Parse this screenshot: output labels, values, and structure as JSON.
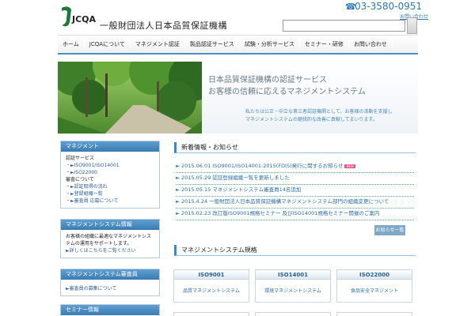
{
  "header": {
    "site_title": "一般財団法人日本品質保証機構",
    "phone": "03-3580-0951",
    "contact_link": "お問い合わせ",
    "logo_text": "JCQA",
    "search": {
      "value": "",
      "placeholder": ""
    }
  },
  "nav": {
    "items": [
      "ホーム",
      "JCQAについて",
      "マネジメント認証",
      "製品認証サービス",
      "試験・分析サービス",
      "セミナー・研修",
      "お問い合わせ"
    ]
  },
  "hero": {
    "heading_line1": "日本品質保証機構の認証サービス",
    "heading_line2": "お客様の信頼に応えるマネジメントシステム",
    "body_line1": "私たちは公正・中立な第三者認証機関として、お客様の活動を支援し",
    "body_line2": "マネジメントシステムの継続的な改善に貢献してまいります。"
  },
  "sidebar": {
    "boxes": [
      {
        "title": "マネジメント",
        "lines": [
          "認証サービス",
          "・►ISO9001/ISO14001",
          "・►ISO22000",
          "審査について",
          "・►認証取得の流れ",
          "・►登録組織一覧",
          "・►審査員 応募について"
        ]
      },
      {
        "title": "マネジメントシステム情報",
        "text": "お客様の組織に最適なマネジメントシステムの運用をサポートします。",
        "link": "►詳しくはこちらをご覧ください"
      },
      {
        "title": "マネジメントシステム審査員",
        "link": "►審査員の募集について"
      },
      {
        "title": "セミナー情報"
      }
    ]
  },
  "news": {
    "title": "新着情報・お知らせ",
    "items": [
      {
        "text": "2015.06.01 ISO9001/ISO14001:2015(FDIS)発行に関するお知らせ",
        "new": true
      },
      {
        "text": "2015.05.29 認証登録組織一覧を更新しました",
        "new": false
      },
      {
        "text": "2015.05.15 マネジメントシステム審査員14名追加",
        "new": false
      },
      {
        "text": "2015.4.24 一般財団法人日本品質保証機構マネジメントシステム部門の組織変更について",
        "new": false
      },
      {
        "text": "2015.02.23 改訂版ISO9001規格セミナー 及びISO14001規格セミナー開催のご案内",
        "new": false
      }
    ],
    "new_badge": "NEW",
    "more_button": "お知らせ一覧"
  },
  "standards": {
    "title": "マネジメントシステム規格",
    "cards": [
      {
        "name": "ISO9001",
        "link": "品質マネジメントシステム"
      },
      {
        "name": "ISO14001",
        "link": "環境マネジメントシステム"
      },
      {
        "name": "ISO22000",
        "link": "食品安全マネジメント"
      }
    ]
  },
  "colors": {
    "accent": "#3a89c2",
    "link": "#2a6ea8",
    "badge": "#e9508a"
  }
}
